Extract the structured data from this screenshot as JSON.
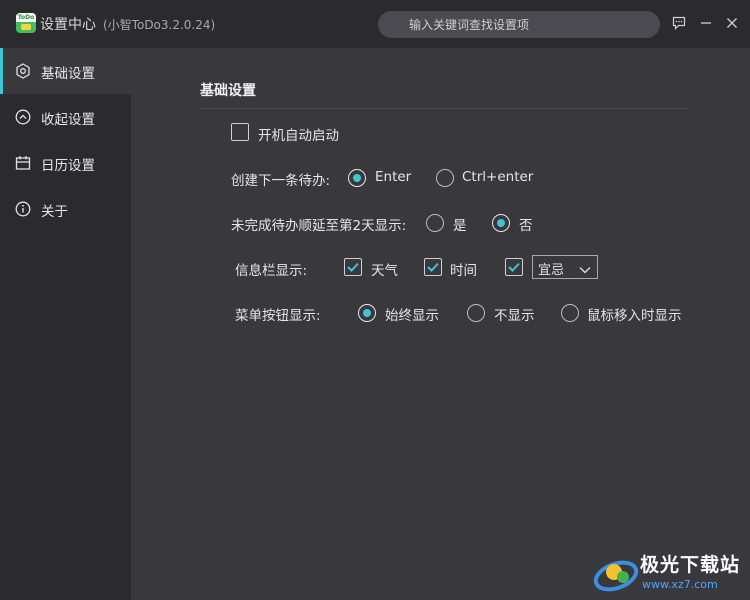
{
  "window": {
    "title": "设置中心",
    "version": "(小智ToDo3.2.0.24)",
    "logo_text": "ToDo",
    "search": {
      "placeholder": "输入关键词查找设置项",
      "value": ""
    }
  },
  "sidebar": {
    "items": [
      {
        "label": "基础设置",
        "icon": "gear-icon",
        "active": true
      },
      {
        "label": "收起设置",
        "icon": "chevron-up-icon",
        "active": false
      },
      {
        "label": "日历设置",
        "icon": "calendar-icon",
        "active": false
      },
      {
        "label": "关于",
        "icon": "info-icon",
        "active": false
      }
    ]
  },
  "main": {
    "section_title": "基础设置",
    "autostart": {
      "label": "开机自动启动",
      "checked": false
    },
    "create_next": {
      "label": "创建下一条待办:",
      "options": [
        {
          "label": "Enter",
          "checked": true
        },
        {
          "label": "Ctrl+enter",
          "checked": false
        }
      ]
    },
    "postpone": {
      "label": "未完成待办顺延至第2天显示:",
      "options": [
        {
          "label": "是",
          "checked": false
        },
        {
          "label": "否",
          "checked": true
        }
      ]
    },
    "infobar": {
      "label": "信息栏显示:",
      "weather": {
        "label": "天气",
        "checked": true
      },
      "time": {
        "label": "时间",
        "checked": true
      },
      "almanac": {
        "checked": true,
        "selected": "宜忌"
      }
    },
    "menu_button": {
      "label": "菜单按钮显示:",
      "options": [
        {
          "label": "始终显示",
          "checked": true
        },
        {
          "label": "不显示",
          "checked": false
        },
        {
          "label": "鼠标移入时显示",
          "checked": false
        }
      ]
    }
  },
  "watermark": {
    "text": "极光下载站",
    "url": "www.xz7.com"
  },
  "colors": {
    "accent": "#3fc6d6",
    "sidebar_bg": "#2b2b2f",
    "content_bg": "#38383d"
  }
}
